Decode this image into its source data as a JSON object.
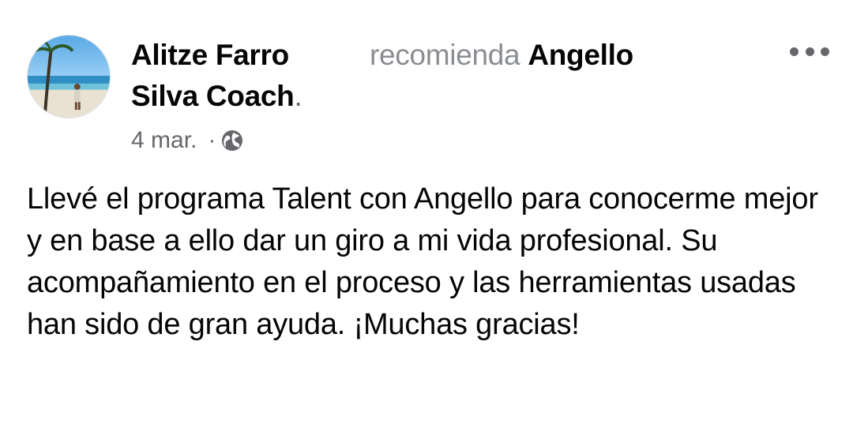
{
  "post": {
    "author_line1": "Alitze Farro",
    "author_line2": "Silva Coach",
    "author_period": ".",
    "recommend_verb": "recomienda",
    "recommend_target": "Angello",
    "date": "4 mar.",
    "separator": "·",
    "audience_icon": "globe-icon",
    "more_icon": "more-options-icon",
    "body": "Llevé el programa Talent con Angello para conocerme mejor y en base a ello dar un giro a mi vida profesional. Su acompañamiento en el proceso y las herramientas usadas han sido de gran ayuda. ¡Muchas gracias!"
  },
  "colors": {
    "primary_text": "#050505",
    "secondary_text": "#65676b",
    "muted_text": "#8a8d91"
  }
}
